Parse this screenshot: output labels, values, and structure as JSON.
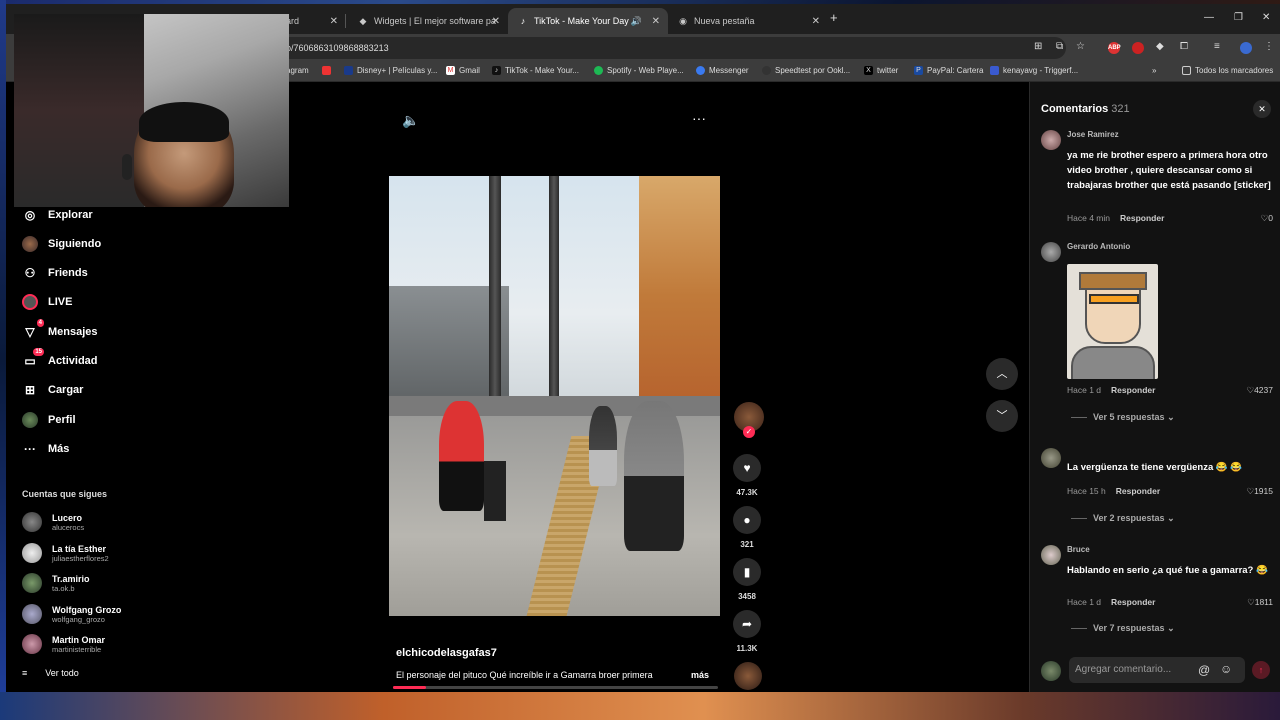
{
  "browser": {
    "tabs": [
      {
        "label": "ard",
        "active": false
      },
      {
        "label": "Widgets | El mejor software pa",
        "active": false
      },
      {
        "label": "TikTok - Make Your Day",
        "active": true
      },
      {
        "label": "Nueva pestaña",
        "active": false
      }
    ],
    "url": "o/7606863109868883213",
    "bookmarks": [
      "agram",
      "Disney+ | Películas y...",
      "Gmail",
      "TikTok - Make Your...",
      "Spotify - Web Playe...",
      "Messenger",
      "Speedtest por Ookl...",
      "twitter",
      "PayPal: Cartera",
      "kenayavg - Triggerf..."
    ],
    "all_bookmarks": "Todos los marcadores",
    "ext_abp": "ABP"
  },
  "sidebar": {
    "items": [
      {
        "label": "Explorar",
        "icon": "compass-icon",
        "glyph": "◎"
      },
      {
        "label": "Siguiendo",
        "icon": "following-avatar-icon",
        "glyph": ""
      },
      {
        "label": "Friends",
        "icon": "friends-icon",
        "glyph": "⚇"
      },
      {
        "label": "LIVE",
        "icon": "live-icon",
        "glyph": ""
      },
      {
        "label": "Mensajes",
        "icon": "messages-icon",
        "glyph": "▽",
        "badge": "4"
      },
      {
        "label": "Actividad",
        "icon": "activity-icon",
        "glyph": "▭",
        "badge": "15"
      },
      {
        "label": "Cargar",
        "icon": "upload-icon",
        "glyph": "⊞"
      },
      {
        "label": "Perfil",
        "icon": "profile-icon",
        "glyph": ""
      },
      {
        "label": "Más",
        "icon": "more-icon",
        "glyph": "···"
      }
    ],
    "following_title": "Cuentas que sigues",
    "following": [
      {
        "name": "Lucero",
        "handle": "alucerocs"
      },
      {
        "name": "La tía Esther",
        "handle": "juliaestherflores2"
      },
      {
        "name": "Tr.amirio",
        "handle": "ta.ok.b"
      },
      {
        "name": "Wolfgang Grozo",
        "handle": "wolfgang_grozo"
      },
      {
        "name": "Martin Omar",
        "handle": "martinisterrible"
      }
    ],
    "see_all": "Ver todo"
  },
  "video": {
    "username": "elchicodelasgafas7",
    "caption": "El personaje del pituco Qué increíble ir a Gamarra broer primera",
    "more": "más",
    "progress": 0.1,
    "actions": [
      {
        "name": "like",
        "glyph": "♥",
        "count": "47.3K"
      },
      {
        "name": "comment",
        "glyph": "●",
        "count": "321"
      },
      {
        "name": "save",
        "glyph": "▮",
        "count": "3458"
      },
      {
        "name": "share",
        "glyph": "➦",
        "count": "11.3K"
      }
    ]
  },
  "comments": {
    "title": "Comentarios",
    "count": "321",
    "input_placeholder": "Agregar comentario...",
    "items": [
      {
        "user": "Jose Ramirez",
        "text": "ya me rie brother espero a primera hora otro video brother , quiere descansar como si trabajaras brother que está pasando [sticker]",
        "time": "Hace 4 min",
        "reply": "Responder",
        "likes": "0"
      },
      {
        "user": "Gerardo Antonio",
        "text": "",
        "time": "Hace 1 d",
        "reply": "Responder",
        "likes": "4237",
        "replies": "Ver 5 respuestas"
      },
      {
        "user": "",
        "text": "La vergüenza te tiene vergüenza 😂 😂",
        "time": "Hace 15 h",
        "reply": "Responder",
        "likes": "1915",
        "replies": "Ver 2 respuestas"
      },
      {
        "user": "Bruce",
        "text": "Hablando en serio ¿a qué fue a gamarra? 😂",
        "time": "Hace 1 d",
        "reply": "Responder",
        "likes": "1811",
        "replies": "Ver 7 respuestas"
      }
    ]
  },
  "colors": {
    "accent": "#fe2c55",
    "background": "#000000",
    "panel": "#121212"
  }
}
